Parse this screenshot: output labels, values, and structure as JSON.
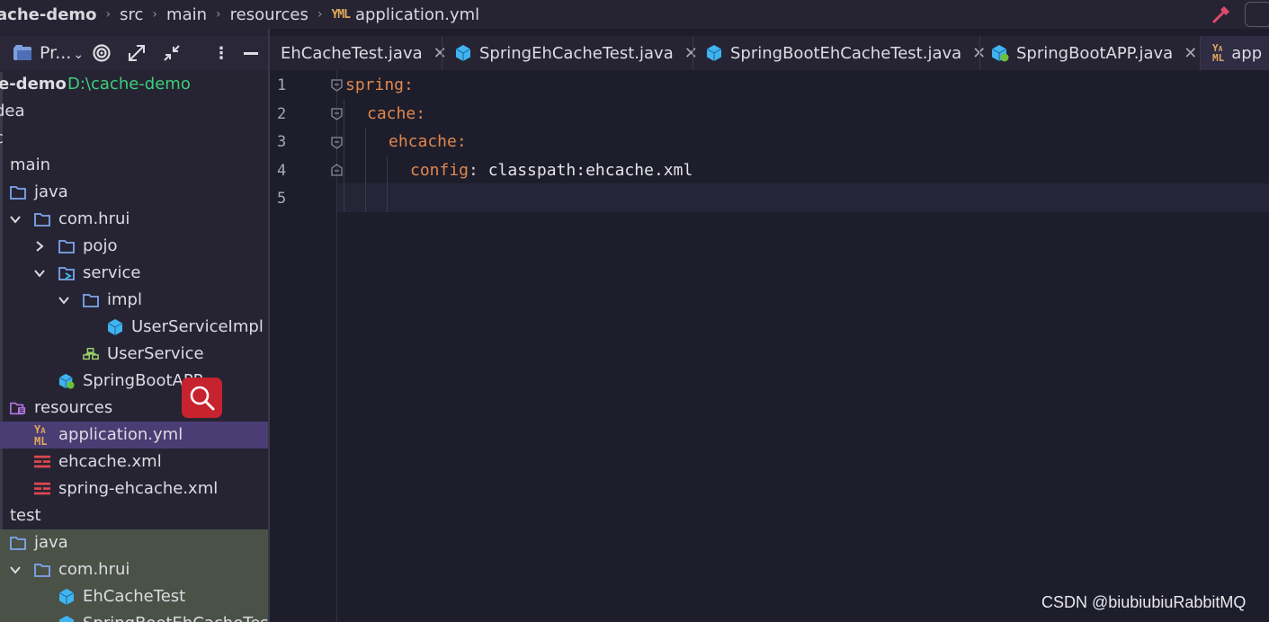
{
  "breadcrumb": {
    "items": [
      "ache-demo",
      "src",
      "main",
      "resources",
      "application.yml"
    ],
    "file_icon_text": "YML"
  },
  "project_panel": {
    "title": "Pr...",
    "tree": [
      {
        "label": "e-demo",
        "path": "D:\\cache-demo",
        "icon": "module-icon"
      },
      {
        "label": "dea",
        "icon": "folder-icon"
      },
      {
        "label": "c",
        "icon": "folder-icon"
      },
      {
        "label": "main",
        "icon": "folder-icon"
      },
      {
        "label": "java",
        "icon": "source-folder-icon"
      },
      {
        "label": "com.hrui",
        "icon": "package-icon",
        "expanded": true
      },
      {
        "label": "pojo",
        "icon": "package-icon",
        "expanded": false
      },
      {
        "label": "service",
        "icon": "package-icon",
        "expanded": true
      },
      {
        "label": "impl",
        "icon": "package-icon",
        "expanded": true
      },
      {
        "label": "UserServiceImpl",
        "icon": "class-icon"
      },
      {
        "label": "UserService",
        "icon": "interface-icon"
      },
      {
        "label": "SpringBootAPP",
        "icon": "spring-class-icon"
      },
      {
        "label": "resources",
        "icon": "resources-folder-icon"
      },
      {
        "label": "application.yml",
        "icon": "yaml-file-icon",
        "selected": true
      },
      {
        "label": "ehcache.xml",
        "icon": "xml-file-icon"
      },
      {
        "label": "spring-ehcache.xml",
        "icon": "xml-file-icon"
      },
      {
        "label": "test",
        "icon": "folder-icon"
      },
      {
        "label": "java",
        "icon": "test-folder-icon"
      },
      {
        "label": "com.hrui",
        "icon": "package-icon",
        "expanded": true
      },
      {
        "label": "EhCacheTest",
        "icon": "class-icon"
      },
      {
        "label": "SpringBootEhCacheTest",
        "icon": "class-icon"
      }
    ]
  },
  "tabs": [
    {
      "label": "EhCacheTest.java",
      "icon": "class-icon"
    },
    {
      "label": "SpringEhCacheTest.java",
      "icon": "class-icon"
    },
    {
      "label": "SpringBootEhCacheTest.java",
      "icon": "class-icon"
    },
    {
      "label": "SpringBootAPP.java",
      "icon": "spring-class-icon"
    },
    {
      "label": "app",
      "icon": "yaml-file-icon"
    }
  ],
  "editor": {
    "line_numbers": [
      "1",
      "2",
      "3",
      "4",
      "5"
    ],
    "lines": [
      {
        "key": "spring",
        "punc": ":",
        "value": ""
      },
      {
        "key": "cache",
        "punc": ":",
        "value": ""
      },
      {
        "key": "ehcache",
        "punc": ":",
        "value": ""
      },
      {
        "key": "config",
        "punc": ":",
        "value": " classpath:ehcache.xml"
      },
      {
        "key": "",
        "punc": "",
        "value": ""
      }
    ]
  },
  "watermark": "CSDN @biubiubiuRabbitMQ",
  "colors": {
    "background": "#1e1d2b",
    "panel": "#262433",
    "selected_row": "#4a3d73",
    "yaml_key": "#e0884e",
    "path_green": "#3ccf7a",
    "search_badge": "#c6232e"
  }
}
